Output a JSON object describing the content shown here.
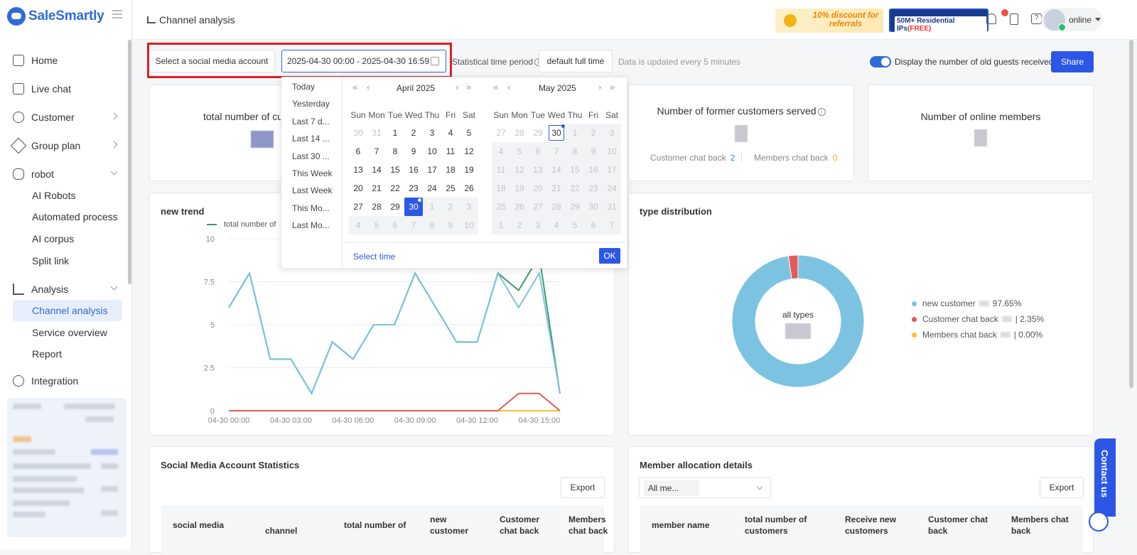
{
  "brand": {
    "name": "SaleSmartly"
  },
  "sidebar": {
    "items": [
      {
        "label": "Home"
      },
      {
        "label": "Live chat"
      },
      {
        "label": "Customer"
      },
      {
        "label": "Group plan"
      },
      {
        "label": "robot"
      },
      {
        "label": "AI Robots"
      },
      {
        "label": "Automated process"
      },
      {
        "label": "AI corpus"
      },
      {
        "label": "Split link"
      },
      {
        "label": "Analysis"
      },
      {
        "label": "Channel analysis"
      },
      {
        "label": "Service overview"
      },
      {
        "label": "Report"
      },
      {
        "label": "Integration"
      }
    ]
  },
  "header": {
    "title": "Channel analysis",
    "promo1": "10% discount for referrals",
    "promo2_a": "50M+ Residential IPs",
    "promo2_b": "(FREE)",
    "user_status": "online"
  },
  "filters": {
    "account_select": "Select a social media account",
    "date_range": "2025-04-30 00:00 - 2025-04-30 16:59",
    "time_period_label": "Statistical time period",
    "period_button": "default full time",
    "update_note": "Data is updated every 5 minutes",
    "toggle_label": "Display the number of old guests received",
    "share": "Share"
  },
  "date_picker": {
    "shortcuts": [
      "Today",
      "Yesterday",
      "Last 7 d...",
      "Last 14 ...",
      "Last 30 ...",
      "This Week",
      "Last Week",
      "This Mo...",
      "Last Mo..."
    ],
    "left_month": "April 2025",
    "right_month": "May 2025",
    "weekdays": [
      "Sun",
      "Mon",
      "Tue",
      "Wed",
      "Thu",
      "Fri",
      "Sat"
    ],
    "select_time": "Select time",
    "ok": "OK"
  },
  "cards": {
    "total_customers": "total number of cus",
    "former_customers": "Number of former customers served",
    "customer_chat_back": "Customer chat back",
    "customer_chat_back_value": "2",
    "members_chat_back": "Members chat back",
    "members_chat_back_value": "0",
    "online_members": "Number of online members"
  },
  "trend": {
    "title": "new trend",
    "legend": "total number of"
  },
  "chart_data": {
    "type": "line",
    "x": [
      "04-30 00:00",
      "04-30 01:00",
      "04-30 02:00",
      "04-30 03:00",
      "04-30 04:00",
      "04-30 05:00",
      "04-30 06:00",
      "04-30 07:00",
      "04-30 08:00",
      "04-30 09:00",
      "04-30 10:00",
      "04-30 11:00",
      "04-30 12:00",
      "04-30 13:00",
      "04-30 14:00",
      "04-30 15:00",
      "04-30 16:00"
    ],
    "xticks": [
      "04-30 00:00",
      "04-30 03:00",
      "04-30 06:00",
      "04-30 09:00",
      "04-30 12:00",
      "04-30 15:00"
    ],
    "yticks": [
      "0",
      "2.5",
      "5",
      "7.5",
      "10"
    ],
    "ylim": [
      0,
      10
    ],
    "series": [
      {
        "name": "total number of",
        "color": "#3a9a6e",
        "values": [
          6,
          8,
          3,
          3,
          1,
          4,
          3,
          5,
          5,
          8,
          6,
          4,
          4,
          8,
          7,
          9,
          1
        ]
      },
      {
        "color": "#7cc3dc",
        "values": [
          6,
          8,
          3,
          3,
          1,
          4,
          3,
          5,
          5,
          8,
          6,
          4,
          4,
          8,
          6,
          8,
          1
        ]
      },
      {
        "color": "#e35c5c",
        "values": [
          0,
          0,
          0,
          0,
          0,
          0,
          0,
          0,
          0,
          0,
          0,
          0,
          0,
          0,
          1,
          1,
          0
        ]
      },
      {
        "color": "#f2c230",
        "values": [
          0,
          0,
          0,
          0,
          0,
          0,
          0,
          0,
          0,
          0,
          0,
          0,
          0,
          0,
          0,
          0,
          0
        ]
      }
    ]
  },
  "type_dist": {
    "title": "type distribution",
    "center_label": "all types",
    "chart_data": {
      "type": "pie",
      "labels": [
        "new customer",
        "Customer chat back",
        "Members chat back"
      ],
      "values": [
        97.65,
        2.35,
        0.0
      ],
      "value_labels": [
        "97.65%",
        "2.35%",
        "0.00%"
      ],
      "colors": [
        "#7cc3e2",
        "#e35c5c",
        "#f2c230"
      ]
    }
  },
  "social_table": {
    "title": "Social Media Account Statistics",
    "export": "Export",
    "columns": [
      "social media",
      "channel",
      "total number of",
      "new customer",
      "Customer chat back",
      "Members chat back"
    ]
  },
  "member_table": {
    "title": "Member allocation details",
    "select": "All me...",
    "export": "Export",
    "columns": [
      "member name",
      "total number of customers",
      "Receive new customers",
      "Customer chat back",
      "Members chat back"
    ]
  },
  "contact": "Contact us"
}
